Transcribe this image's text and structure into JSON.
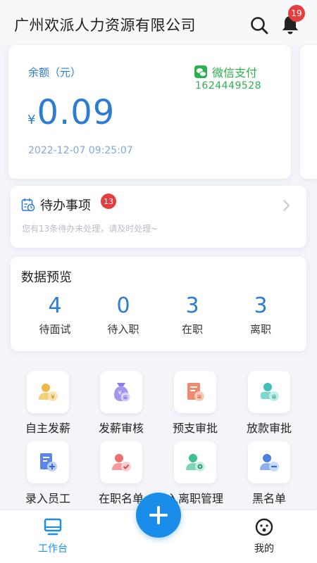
{
  "header": {
    "company_name": "广州欢派人力资源有限公司",
    "notification_count": "19"
  },
  "balance": {
    "label": "余额（元）",
    "currency_symbol": "¥",
    "amount": "0.09",
    "timestamp": "2022-12-07 09:25:07",
    "payment_method": "微信支付",
    "payment_id": "1624449528"
  },
  "todo": {
    "title": "待办事项",
    "badge": "13",
    "subtitle": "您有13条待办未处理，请及时处理~"
  },
  "stats": {
    "title": "数据预览",
    "items": [
      {
        "value": "4",
        "label": "待面试"
      },
      {
        "value": "0",
        "label": "待入职"
      },
      {
        "value": "3",
        "label": "在职"
      },
      {
        "value": "3",
        "label": "离职"
      }
    ]
  },
  "menu": {
    "items": [
      {
        "label": "自主发薪",
        "icon": "self-payroll-icon"
      },
      {
        "label": "发薪审核",
        "icon": "payroll-review-icon"
      },
      {
        "label": "预支审批",
        "icon": "advance-approval-icon"
      },
      {
        "label": "放款审批",
        "icon": "loan-approval-icon"
      },
      {
        "label": "录入员工",
        "icon": "add-employee-icon"
      },
      {
        "label": "在职名单",
        "icon": "active-staff-icon"
      },
      {
        "label": "入离职管理",
        "icon": "onboarding-management-icon"
      },
      {
        "label": "黑名单",
        "icon": "blacklist-icon"
      }
    ]
  },
  "bottom_nav": {
    "workbench_label": "工作台",
    "mine_label": "我的"
  },
  "colors": {
    "primary": "#2b7cd3",
    "fab": "#1a8dea",
    "wechat_green": "#2bb24c",
    "badge_red": "#e53e3e"
  }
}
